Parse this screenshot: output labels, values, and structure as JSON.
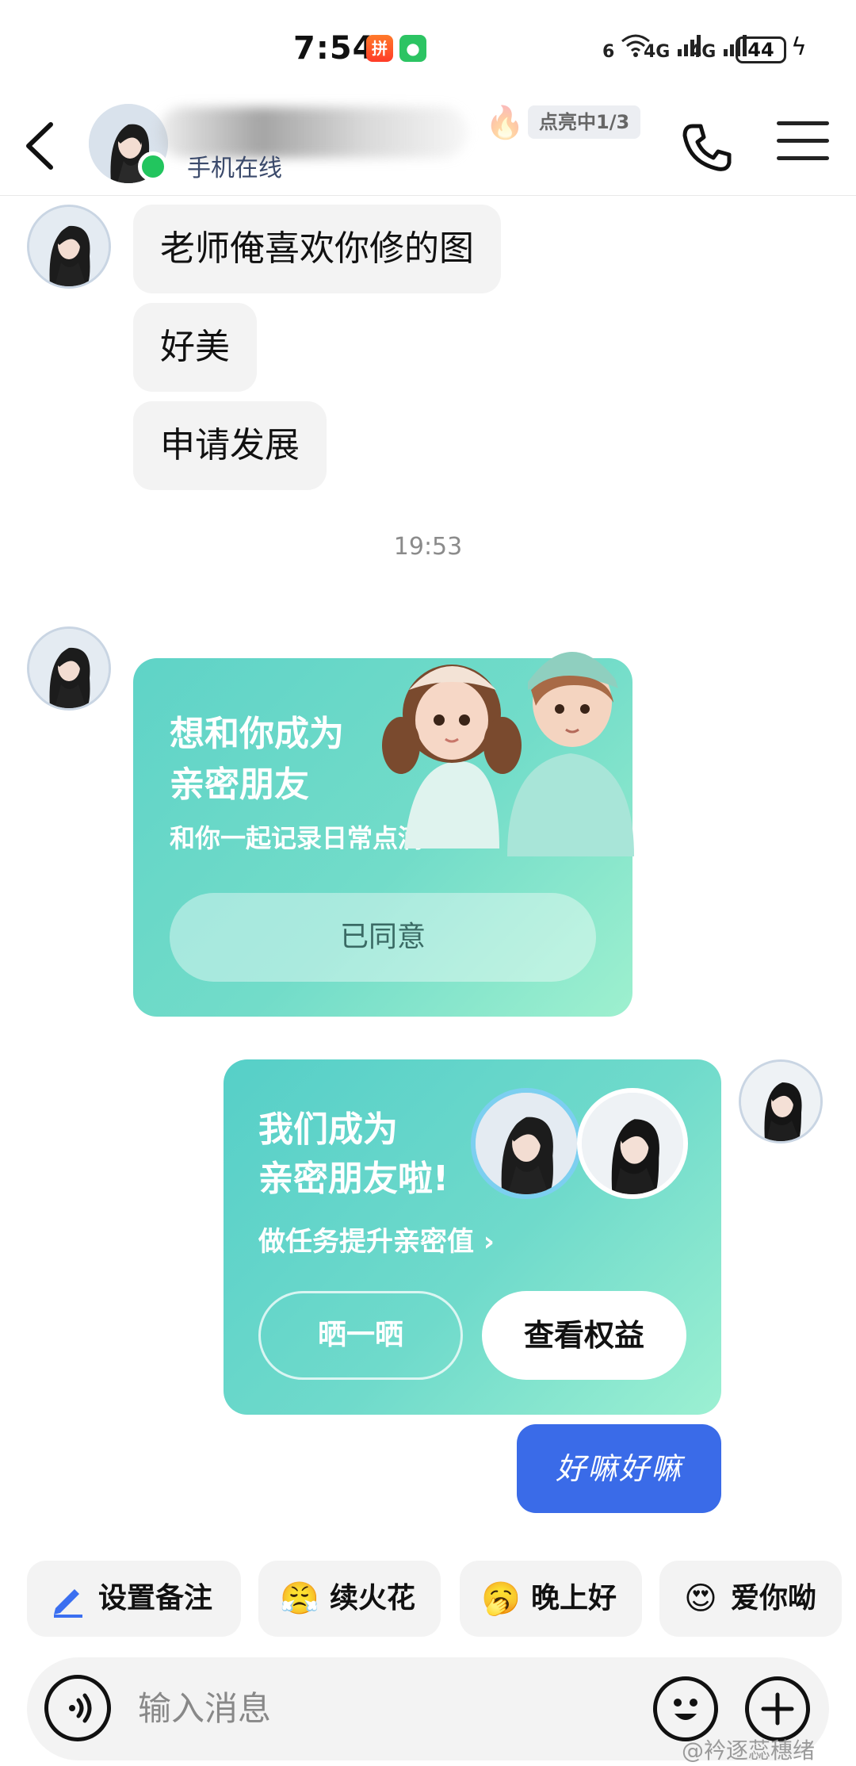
{
  "status_bar": {
    "time": "7:54",
    "signal": [
      "6",
      "4G",
      "4G"
    ],
    "battery": "44"
  },
  "header": {
    "status": "手机在线",
    "spark": "点亮中1/3"
  },
  "messages": {
    "left": [
      "老师俺喜欢你修的图",
      "好美",
      "申请发展"
    ],
    "timestamp": "19:53"
  },
  "card_request": {
    "title_line1": "想和你成为",
    "title_line2": "亲密朋友",
    "subtitle": "和你一起记录日常点滴 ›",
    "button": "已同意"
  },
  "card_success": {
    "title_line1": "我们成为",
    "title_line2": "亲密朋友啦!",
    "subtitle": "做任务提升亲密值 ›",
    "share_button": "晒一晒",
    "rights_button": "查看权益"
  },
  "my_message": "好嘛好嘛",
  "quick_actions": [
    {
      "label": "设置备注",
      "icon": "pencil-icon"
    },
    {
      "label": "续火花",
      "icon": "fire-emoji-icon"
    },
    {
      "label": "晚上好",
      "icon": "sleepy-emoji-icon"
    },
    {
      "label": "爱你呦",
      "icon": "heart-eyes-emoji-icon"
    }
  ],
  "input": {
    "placeholder": "输入消息"
  },
  "watermark": "@衿逐蕊穗绪",
  "colors": {
    "card_teal": "#6fdacb",
    "my_bubble": "#3a6be8",
    "online": "#22c55e"
  }
}
